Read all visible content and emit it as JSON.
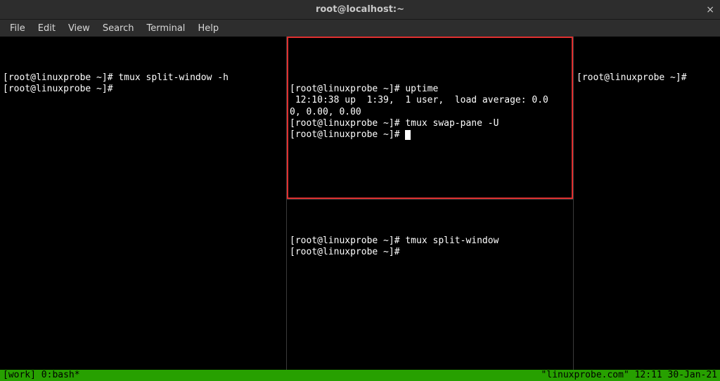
{
  "titlebar": {
    "title": "root@localhost:~",
    "close_label": "×"
  },
  "menubar": {
    "items": [
      "File",
      "Edit",
      "View",
      "Search",
      "Terminal",
      "Help"
    ]
  },
  "panes": {
    "left": {
      "line1": "[root@linuxprobe ~]# tmux split-window -h",
      "line2": "[root@linuxprobe ~]# "
    },
    "mid_top": {
      "line1": "[root@linuxprobe ~]# uptime",
      "line2": " 12:10:38 up  1:39,  1 user,  load average: 0.0",
      "line3": "0, 0.00, 0.00",
      "line4": "[root@linuxprobe ~]# tmux swap-pane -U",
      "line5": "[root@linuxprobe ~]# "
    },
    "mid_bottom": {
      "line1": "[root@linuxprobe ~]# tmux split-window",
      "line2": "[root@linuxprobe ~]# "
    },
    "right": {
      "line1": "[root@linuxprobe ~]# "
    }
  },
  "statusbar": {
    "left": "[work] 0:bash*",
    "right": "\"linuxprobe.com\" 12:11 30-Jan-21"
  }
}
